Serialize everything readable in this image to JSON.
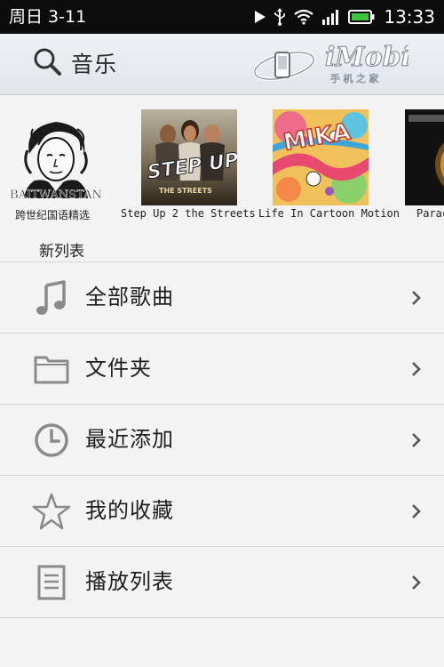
{
  "status_bar": {
    "date": "周日 3-11",
    "time": "13:33",
    "icons": [
      "play-icon",
      "usb-icon",
      "wifi-icon",
      "signal-icon",
      "battery-icon"
    ]
  },
  "header": {
    "title": "音乐",
    "brand": "iMobile",
    "brand_sub": "手 机 之 家"
  },
  "albums": [
    {
      "title": "跨世纪国语精选"
    },
    {
      "title": "Step Up 2 the Streets"
    },
    {
      "title": "Life In Cartoon Motion"
    },
    {
      "title": "Parac"
    }
  ],
  "album_art": {
    "a1_text": "BAITWANSTAN",
    "a2_main": "STEP UP",
    "a2_sub": "THE STREETS",
    "a3_text": "MIKA"
  },
  "section": {
    "label": "新列表"
  },
  "menu": [
    {
      "label": "全部歌曲",
      "icon": "music-note-icon"
    },
    {
      "label": "文件夹",
      "icon": "folder-icon"
    },
    {
      "label": "最近添加",
      "icon": "clock-icon"
    },
    {
      "label": "我的收藏",
      "icon": "star-icon"
    },
    {
      "label": "播放列表",
      "icon": "list-icon"
    }
  ],
  "colors": {
    "status_bar_bg": "#0c0c0c",
    "header_bg": "#e6e9ed",
    "page_bg": "#f3f3f3",
    "battery_green": "#3ec43e",
    "icon_gray": "#8a8a8a"
  }
}
